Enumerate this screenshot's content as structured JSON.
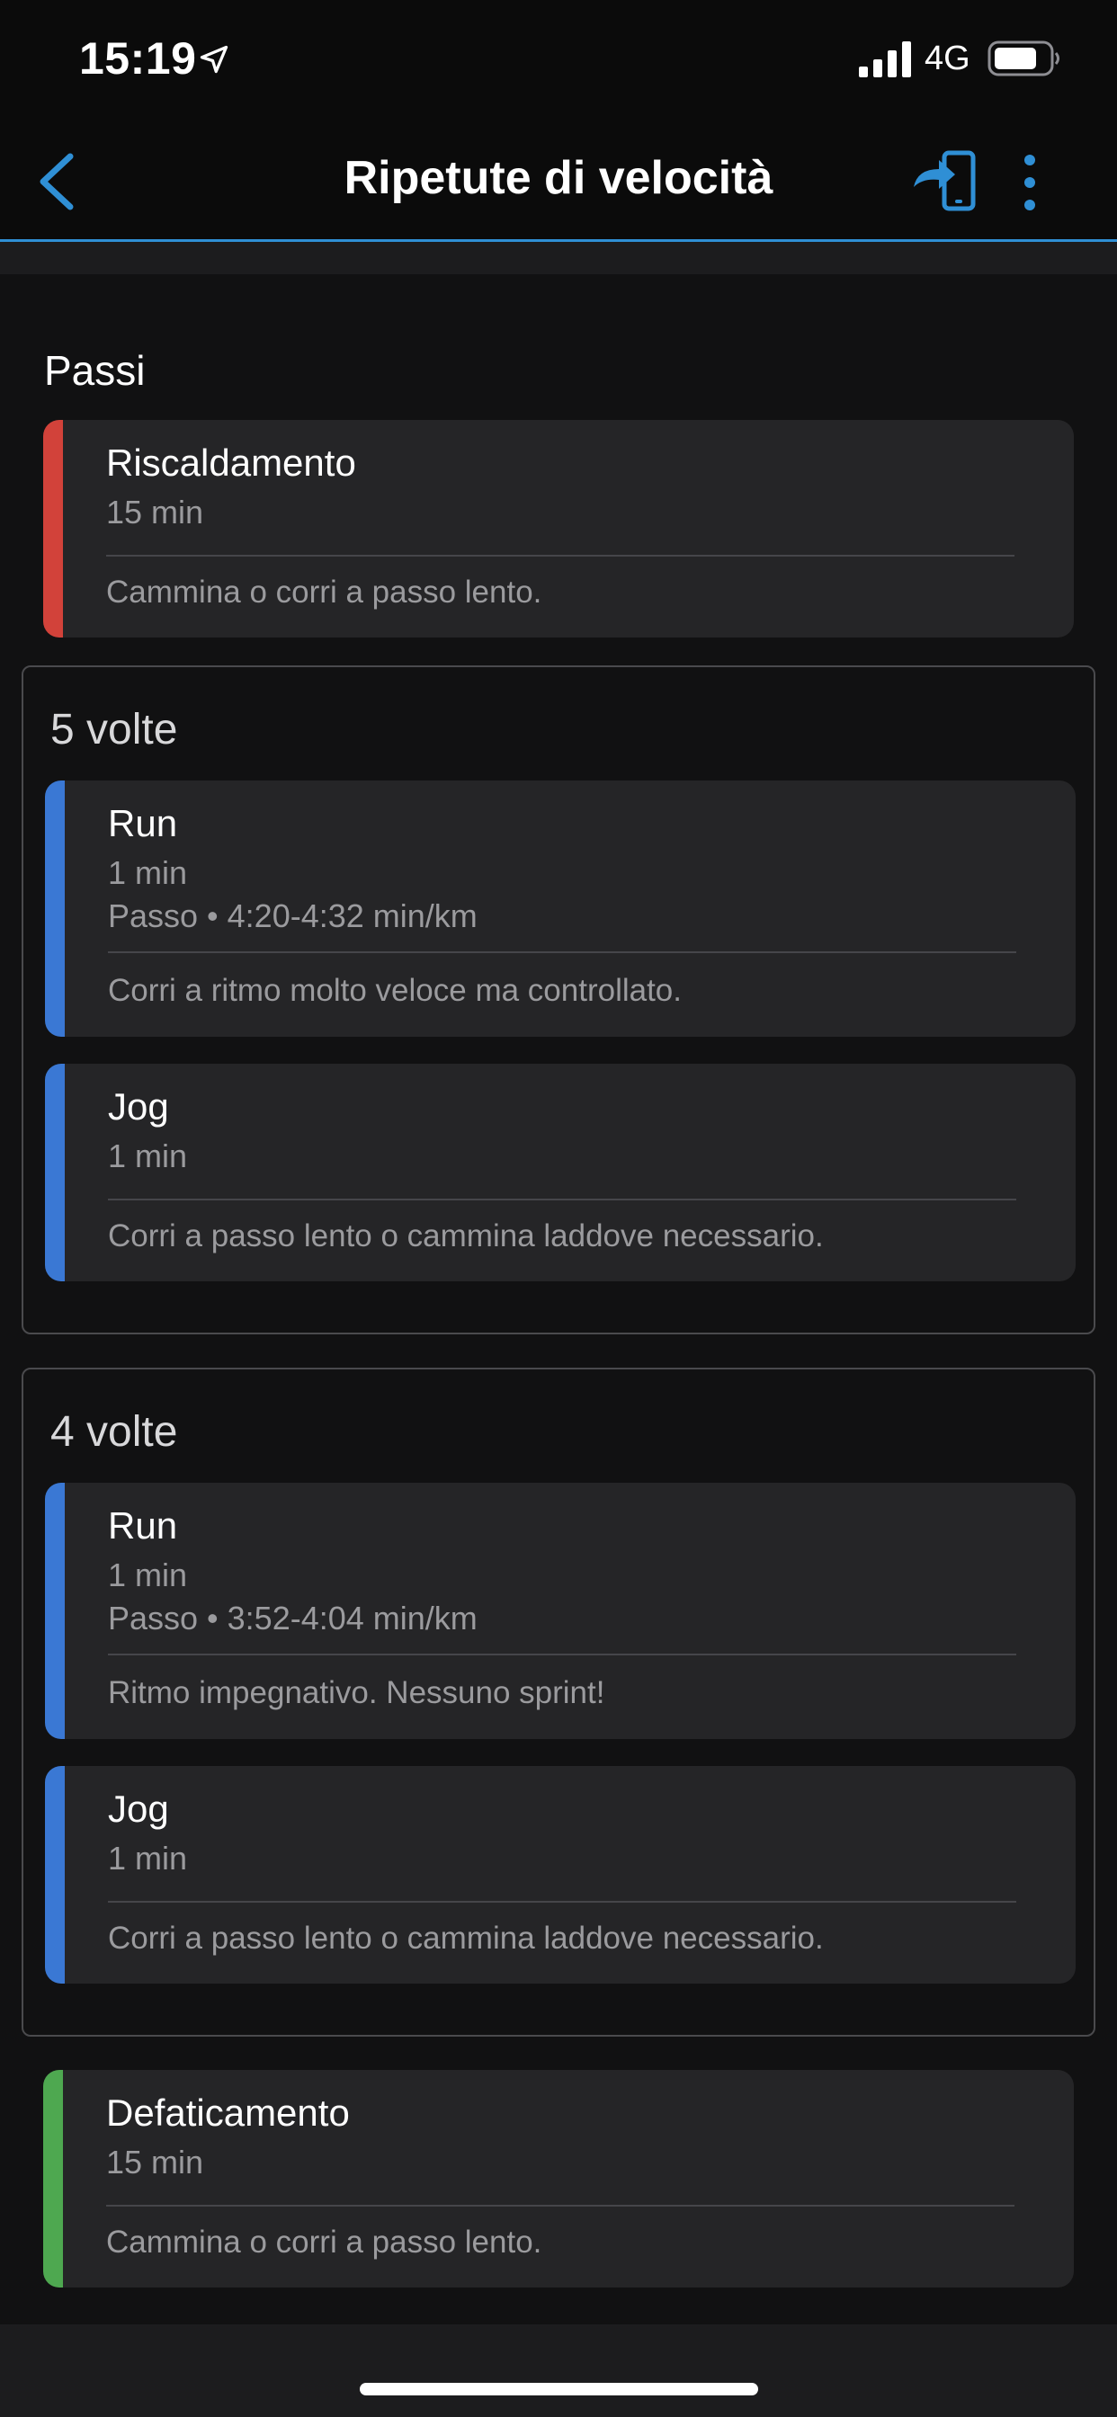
{
  "status_bar": {
    "time": "15:19",
    "network": "4G"
  },
  "nav": {
    "title": "Ripetute di velocità"
  },
  "section": {
    "title": "Passi"
  },
  "warmup": {
    "name": "Riscaldamento",
    "duration": "15 min",
    "note": "Cammina o corri a passo lento.",
    "color": "#d2423a"
  },
  "repeat1": {
    "label": "5 volte",
    "run": {
      "name": "Run",
      "duration": "1 min",
      "target": "Passo • 4:20-4:32 min/km",
      "note": "Corri a ritmo molto veloce ma controllato.",
      "color": "#3a78d4"
    },
    "jog": {
      "name": "Jog",
      "duration": "1 min",
      "note": "Corri a passo lento o cammina laddove necessario.",
      "color": "#3a78d4"
    }
  },
  "repeat2": {
    "label": "4 volte",
    "run": {
      "name": "Run",
      "duration": "1 min",
      "target": "Passo • 3:52-4:04 min/km",
      "note": "Ritmo impegnativo. Nessuno sprint!",
      "color": "#3a78d4"
    },
    "jog": {
      "name": "Jog",
      "duration": "1 min",
      "note": "Corri a passo lento o cammina laddove necessario.",
      "color": "#3a78d4"
    }
  },
  "cooldown": {
    "name": "Defaticamento",
    "duration": "15 min",
    "note": "Cammina o corri a passo lento.",
    "color": "#4ea850"
  },
  "icons": {
    "location": "location-arrow-icon",
    "signal": "signal-icon",
    "battery": "battery-icon",
    "back": "chevron-left-icon",
    "send": "send-to-device-icon",
    "more": "more-vertical-icon"
  },
  "accent": "#2f8fd5"
}
